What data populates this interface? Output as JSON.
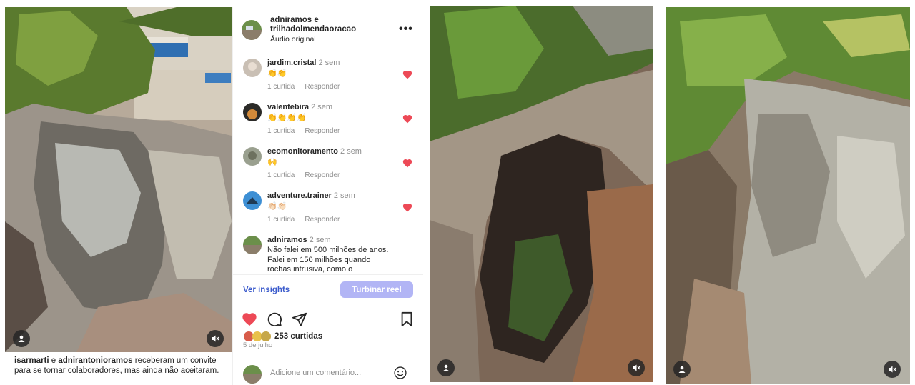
{
  "post": {
    "header": {
      "name_line1": "adniramos e",
      "name_line2": "trilhadolmendaoracao",
      "audio": "Áudio original",
      "more": "•••"
    },
    "comments": [
      {
        "user": "jardim.cristal",
        "time": "2 sem",
        "text": "👏👏",
        "likes": "1 curtida",
        "reply": "Responder",
        "liked": true
      },
      {
        "user": "valentebira",
        "time": "2 sem",
        "text": "👏👏👏👏",
        "likes": "1 curtida",
        "reply": "Responder",
        "liked": true
      },
      {
        "user": "ecomonitoramento",
        "time": "2 sem",
        "text": "🙌",
        "likes": "1 curtida",
        "reply": "Responder",
        "liked": true
      },
      {
        "user": "adventure.trainer",
        "time": "2 sem",
        "text": "👏🏻👏🏻",
        "likes": "1 curtida",
        "reply": "Responder",
        "liked": true
      },
      {
        "user": "adniramos",
        "time": "2 sem",
        "text": "Não falei em 500 milhões de anos. Falei em 150 milhões quando rochas intrusiva, como o"
      }
    ],
    "insights": "Ver insights",
    "boost": "Turbinar reel",
    "likes": "253 curtidas",
    "date": "5 de julho",
    "add_comment_placeholder": "Adicione um comentário...",
    "heart_color": "#ed4956"
  },
  "caption": {
    "user1": "isarmarti",
    "joiner": " e ",
    "user2": "adnirantonioramos",
    "rest": " receberam um convite para se tornar colaboradores, mas ainda não aceitaram."
  },
  "icons": {
    "heart": "heart-icon",
    "comment": "comment-icon",
    "share": "share-icon",
    "save": "bookmark-icon",
    "mute": "mute-icon",
    "user": "user-icon",
    "emoji": "emoji-icon"
  }
}
